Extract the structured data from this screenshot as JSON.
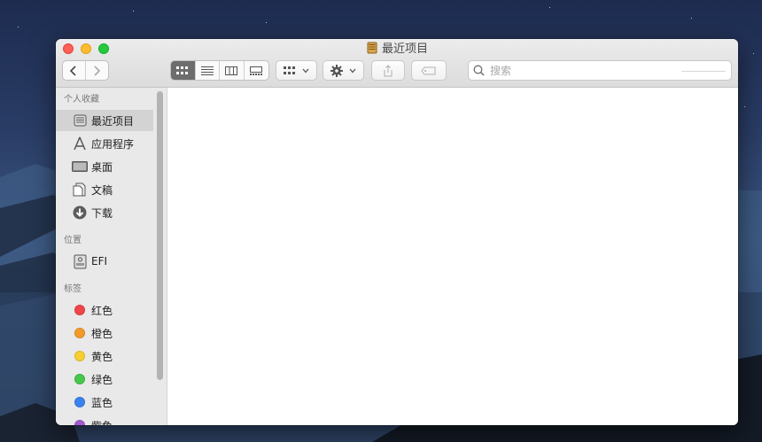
{
  "window": {
    "title": "最近项目"
  },
  "toolbar": {
    "back_icon": "chevron-left-icon",
    "forward_icon": "chevron-right-icon",
    "view_modes": [
      "icon-view",
      "list-view",
      "column-view",
      "gallery-view"
    ],
    "active_view": "icon-view",
    "search": {
      "placeholder": "搜索",
      "value": ""
    }
  },
  "sidebar": {
    "favorites": {
      "heading": "个人收藏",
      "items": [
        {
          "label": "最近项目",
          "icon": "recents-icon",
          "selected": true
        },
        {
          "label": "应用程序",
          "icon": "applications-icon"
        },
        {
          "label": "桌面",
          "icon": "desktop-icon"
        },
        {
          "label": "文稿",
          "icon": "documents-icon"
        },
        {
          "label": "下载",
          "icon": "downloads-icon"
        }
      ]
    },
    "locations": {
      "heading": "位置",
      "items": [
        {
          "label": "EFI",
          "icon": "disk-icon"
        }
      ]
    },
    "tags": {
      "heading": "标签",
      "items": [
        {
          "label": "红色",
          "color": "#f1454a"
        },
        {
          "label": "橙色",
          "color": "#f49a2c"
        },
        {
          "label": "黄色",
          "color": "#f8cf30"
        },
        {
          "label": "绿色",
          "color": "#47c74c"
        },
        {
          "label": "蓝色",
          "color": "#3b82f0"
        },
        {
          "label": "紫色",
          "color": "#a25ad1"
        }
      ]
    }
  }
}
